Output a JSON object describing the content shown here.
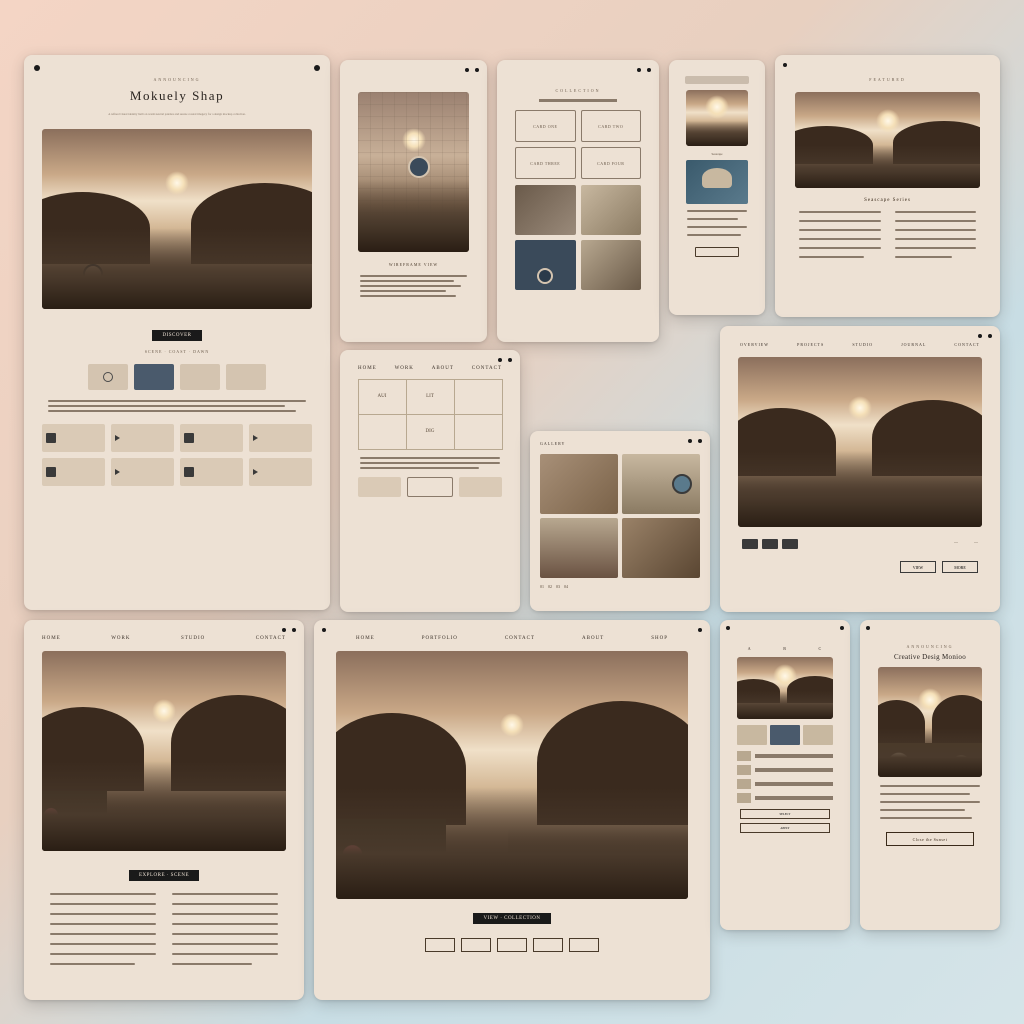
{
  "c1": {
    "eyebrow": "ANNOUNCING",
    "title": "Mokuely Shap",
    "body": "A refined visual identity built on warm neutral palettes and serene coastal imagery for a design mockup collection.",
    "cta": "DISCOVER",
    "meta": "SCENE · COAST · DAWN",
    "swatches": [
      "",
      "",
      "",
      ""
    ],
    "controls": [
      "Item",
      "Play",
      "Item",
      "Play",
      "Item",
      "Play",
      "Item",
      "Play"
    ]
  },
  "c2": {
    "caption": "WIREFRAME VIEW"
  },
  "c3": {
    "eyebrow": "COLLECTION",
    "items": [
      "CARD ONE",
      "CARD TWO",
      "CARD THREE",
      "CARD FOUR"
    ]
  },
  "c4": {
    "caption": "Seascape"
  },
  "c5": {
    "eyebrow": "FEATURED",
    "caption": "Seascape Series"
  },
  "c6": {
    "nav": [
      "HOME",
      "WORK",
      "ABOUT",
      "CONTACT"
    ],
    "cells": [
      "AUI",
      "LIT",
      "",
      "",
      "DIG",
      ""
    ]
  },
  "c7": {
    "nav": "GALLERY",
    "footer": [
      "01",
      "02",
      "03",
      "04"
    ]
  },
  "c8": {
    "nav": [
      "OVERVIEW",
      "PROJECTS",
      "STUDIO",
      "JOURNAL",
      "CONTACT"
    ],
    "buttons": [
      "VIEW",
      "MORE"
    ]
  },
  "c9": {
    "nav": [
      "HOME",
      "WORK",
      "STUDIO",
      "CONTACT"
    ],
    "cta": "EXPLORE · SCENE"
  },
  "c10": {
    "nav": [
      "HOME",
      "PORTFOLIO",
      "CONTACT",
      "ABOUT",
      "SHOP"
    ],
    "cta": "VIEW · COLLECTION"
  },
  "c11": {
    "nav": [
      "A",
      "B",
      "C"
    ],
    "buttons": [
      "SELECT",
      "APPLY"
    ]
  },
  "c12": {
    "eyebrow": "ANNOUNCING",
    "title": "Creative Desig Monioo",
    "cta": "Close the Sunset"
  }
}
